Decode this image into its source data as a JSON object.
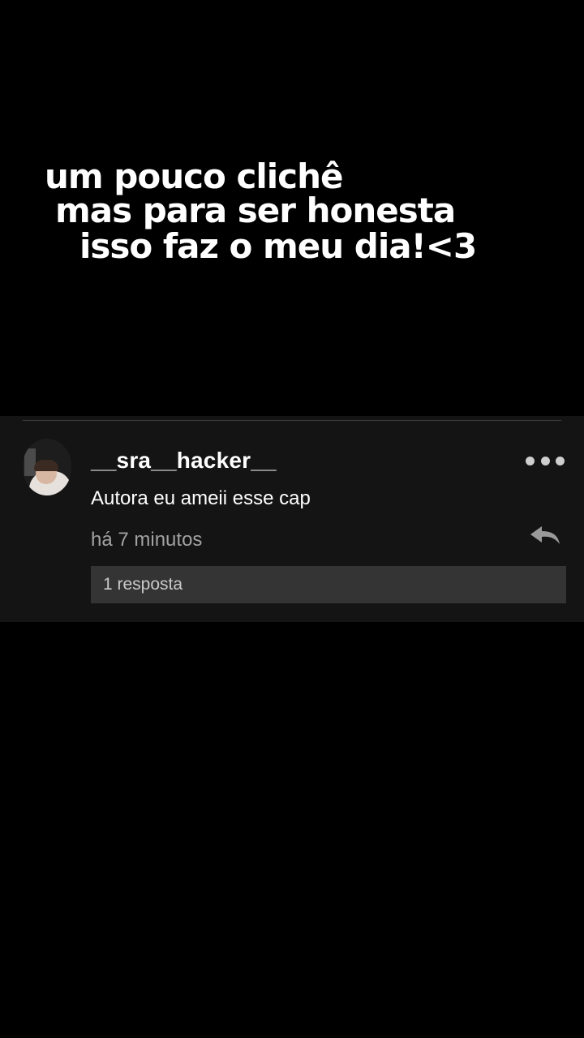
{
  "caption": {
    "line1": "um pouco clichê",
    "line2": "mas para ser honesta",
    "line3": "isso faz o meu dia!<3"
  },
  "comment": {
    "avatar_icon": "user-avatar-photo",
    "username": "__sra__hacker__",
    "more_icon": "more-options-icon",
    "text": "Autora eu ameii esse cap",
    "timestamp": "há 7 minutos",
    "reply_icon": "reply-arrow-icon",
    "replies_label": "1 resposta"
  },
  "colors": {
    "background": "#000000",
    "panel": "#141414",
    "replies_bar": "#343434",
    "muted_text": "#a2a2a2"
  }
}
